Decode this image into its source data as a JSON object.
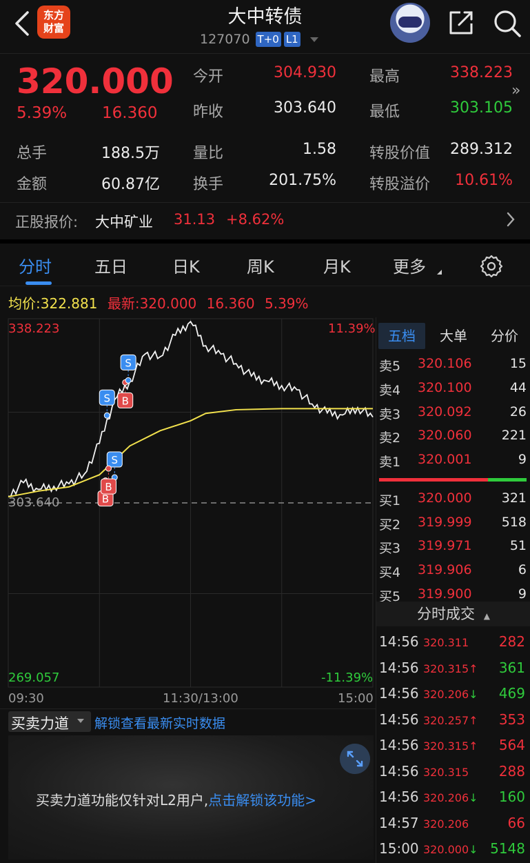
{
  "header": {
    "title": "大中转债",
    "code": "127070",
    "tags": [
      "T+0",
      "L1"
    ],
    "logo_text": [
      "东方",
      "财富"
    ]
  },
  "quote": {
    "price": "320.000",
    "change_pct": "5.39%",
    "change_amt": "16.360",
    "fields": [
      {
        "label": "今开",
        "value": "304.930",
        "color": "red"
      },
      {
        "label": "最高",
        "value": "338.223",
        "color": "red"
      },
      {
        "label": "昨收",
        "value": "303.640",
        "color": "white"
      },
      {
        "label": "最低",
        "value": "303.105",
        "color": "green"
      },
      {
        "label": "总手",
        "value": "188.5万",
        "color": "white"
      },
      {
        "label": "量比",
        "value": "1.58",
        "color": "white"
      },
      {
        "label": "转股价值",
        "value": "289.312",
        "color": "white"
      },
      {
        "label": "金额",
        "value": "60.87亿",
        "color": "white"
      },
      {
        "label": "换手",
        "value": "201.75%",
        "color": "white"
      },
      {
        "label": "转股溢价",
        "value": "10.61%",
        "color": "red"
      }
    ],
    "stock": {
      "label": "正股报价:",
      "name": "大中矿业",
      "price": "31.13",
      "change": "+8.62%"
    }
  },
  "tabs": [
    "分时",
    "五日",
    "日K",
    "周K",
    "月K",
    "更多"
  ],
  "info_line": {
    "avg_label": "均价:",
    "avg_value": "322.881",
    "latest_label": "最新:",
    "latest_value": "320.000",
    "change_amt": "16.360",
    "change_pct": "5.39%"
  },
  "chart_data": {
    "type": "line",
    "title": "",
    "y_max_label": "338.223",
    "y_min_label": "269.057",
    "pct_max_label": "11.39%",
    "pct_min_label": "-11.39%",
    "prev_close_label": "303.640",
    "x_tick_labels": [
      "09:30",
      "11:30/13:00",
      "15:00"
    ],
    "ylim": [
      269.057,
      338.223
    ],
    "prev_close": 303.64,
    "series": [
      {
        "name": "",
        "x": [
          "09:30",
          "09:40",
          "09:50",
          "10:00",
          "10:10",
          "10:20",
          "10:30",
          "10:40",
          "10:50",
          "11:00",
          "11:10",
          "11:20",
          "11:30",
          "13:10",
          "13:20",
          "13:30",
          "13:40",
          "13:50",
          "14:00",
          "14:10",
          "14:20",
          "14:30",
          "14:40",
          "14:50",
          "15:00"
        ],
        "values": [
          304.9,
          307.5,
          306.2,
          306.8,
          307.3,
          309.1,
          315.0,
          323.3,
          326.8,
          332.0,
          331.5,
          335.6,
          338.2,
          333.6,
          332.0,
          330.2,
          327.8,
          326.9,
          326.0,
          325.2,
          322.5,
          320.8,
          320.4,
          321.8,
          320.0
        ]
      },
      {
        "name": "",
        "x": [
          "09:30",
          "09:50",
          "10:10",
          "10:30",
          "10:50",
          "11:10",
          "11:30",
          "13:10",
          "13:30",
          "14:00",
          "14:30",
          "15:00"
        ],
        "values": [
          304.8,
          305.9,
          306.7,
          309.0,
          314.5,
          317.4,
          319.3,
          320.7,
          321.4,
          321.6,
          321.6,
          321.6
        ]
      }
    ],
    "trade_markers": [
      {
        "type": "S",
        "time": "10:35",
        "price": 320.3
      },
      {
        "type": "S",
        "time": "10:40",
        "price": 308.5
      },
      {
        "type": "B",
        "time": "10:34",
        "price": 307.9
      },
      {
        "type": "B",
        "time": "10:36",
        "price": 310.2
      },
      {
        "type": "B",
        "time": "10:47",
        "price": 326.6
      },
      {
        "type": "S",
        "time": "10:49",
        "price": 327.0
      }
    ]
  },
  "order_book": {
    "tabs": [
      "五档",
      "大单",
      "分价"
    ],
    "asks": [
      {
        "label": "卖5",
        "price": "320.106",
        "vol": "15"
      },
      {
        "label": "卖4",
        "price": "320.100",
        "vol": "44"
      },
      {
        "label": "卖3",
        "price": "320.092",
        "vol": "26"
      },
      {
        "label": "卖2",
        "price": "320.060",
        "vol": "221"
      },
      {
        "label": "卖1",
        "price": "320.001",
        "vol": "9"
      }
    ],
    "bids": [
      {
        "label": "买1",
        "price": "320.000",
        "vol": "321"
      },
      {
        "label": "买2",
        "price": "319.999",
        "vol": "518"
      },
      {
        "label": "买3",
        "price": "319.971",
        "vol": "51"
      },
      {
        "label": "买4",
        "price": "319.906",
        "vol": "6"
      },
      {
        "label": "买5",
        "price": "319.900",
        "vol": "9"
      }
    ]
  },
  "ticks": {
    "header": "分时成交",
    "rows": [
      {
        "time": "14:56",
        "price": "320.311",
        "arrow": "",
        "vol": "282",
        "vol_color": "red"
      },
      {
        "time": "14:56",
        "price": "320.315",
        "arrow": "↑",
        "vol": "361",
        "vol_color": "green"
      },
      {
        "time": "14:56",
        "price": "320.206",
        "arrow": "↓",
        "vol": "469",
        "vol_color": "green"
      },
      {
        "time": "14:56",
        "price": "320.257",
        "arrow": "↑",
        "vol": "353",
        "vol_color": "red"
      },
      {
        "time": "14:56",
        "price": "320.315",
        "arrow": "↑",
        "vol": "564",
        "vol_color": "red"
      },
      {
        "time": "14:56",
        "price": "320.315",
        "arrow": "",
        "vol": "288",
        "vol_color": "red"
      },
      {
        "time": "14:56",
        "price": "320.206",
        "arrow": "↓",
        "vol": "160",
        "vol_color": "green"
      },
      {
        "time": "14:57",
        "price": "320.206",
        "arrow": "",
        "vol": "66",
        "vol_color": "red"
      },
      {
        "time": "15:00",
        "price": "320.000",
        "arrow": "↓",
        "vol": "5148",
        "vol_color": "green"
      }
    ]
  },
  "bottom": {
    "select_label": "买卖力道",
    "unlock_link": "解锁查看最新实时数据",
    "l2_text": "买卖力道功能仅针对L2用户,",
    "l2_link": "点击解锁该功能>"
  }
}
